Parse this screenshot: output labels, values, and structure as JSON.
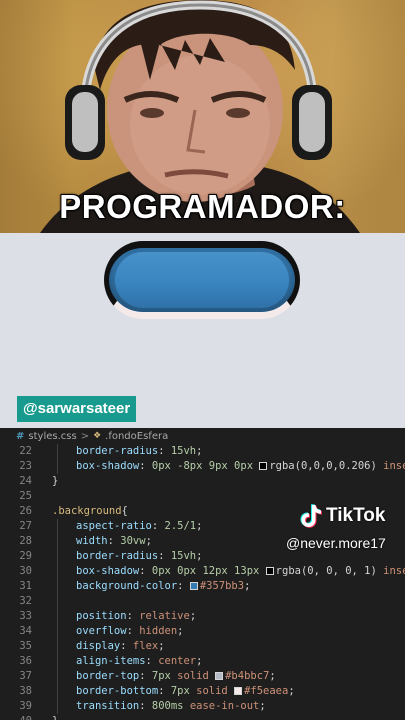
{
  "video": {
    "caption": "PROGRAMADOR:",
    "user_tag": "@sarwarsateer",
    "tiktok_brand": "TikTok",
    "tiktok_handle": "@never.more17"
  },
  "preview": {
    "pill_color": "#357bb3"
  },
  "editor": {
    "breadcrumb": {
      "file": "styles.css",
      "separator": ">",
      "selector": ".fondoEsfera"
    },
    "lines": [
      {
        "n": "22",
        "indent": true,
        "parts": [
          {
            "t": "border-radius",
            "c": "prop"
          },
          {
            "t": ": ",
            "c": "punc"
          },
          {
            "t": "15vh",
            "c": "num"
          },
          {
            "t": ";",
            "c": "punc"
          }
        ]
      },
      {
        "n": "23",
        "indent": true,
        "parts": [
          {
            "t": "box-shadow",
            "c": "prop"
          },
          {
            "t": ": ",
            "c": "punc"
          },
          {
            "t": "0px -8px 9px 0px ",
            "c": "num"
          },
          {
            "sw": "#000000"
          },
          {
            "t": "rgba(0,0,0,0.206) ",
            "c": "punc"
          },
          {
            "t": "inset",
            "c": "val"
          },
          {
            "t": ";",
            "c": "punc"
          }
        ]
      },
      {
        "n": "24",
        "indent": false,
        "parts": [
          {
            "t": "}",
            "c": "punc"
          }
        ]
      },
      {
        "n": "25",
        "indent": false,
        "parts": []
      },
      {
        "n": "26",
        "indent": false,
        "parts": [
          {
            "t": ".background",
            "c": "sel"
          },
          {
            "t": "{",
            "c": "punc"
          }
        ]
      },
      {
        "n": "27",
        "indent": true,
        "parts": [
          {
            "t": "aspect-ratio",
            "c": "prop"
          },
          {
            "t": ": ",
            "c": "punc"
          },
          {
            "t": "2.5/1",
            "c": "num"
          },
          {
            "t": ";",
            "c": "punc"
          }
        ]
      },
      {
        "n": "28",
        "indent": true,
        "parts": [
          {
            "t": "width",
            "c": "prop"
          },
          {
            "t": ": ",
            "c": "punc"
          },
          {
            "t": "30vw",
            "c": "num"
          },
          {
            "t": ";",
            "c": "punc"
          }
        ]
      },
      {
        "n": "29",
        "indent": true,
        "parts": [
          {
            "t": "border-radius",
            "c": "prop"
          },
          {
            "t": ": ",
            "c": "punc"
          },
          {
            "t": "15vh",
            "c": "num"
          },
          {
            "t": ";",
            "c": "punc"
          }
        ]
      },
      {
        "n": "30",
        "indent": true,
        "parts": [
          {
            "t": "box-shadow",
            "c": "prop"
          },
          {
            "t": ": ",
            "c": "punc"
          },
          {
            "t": "0px 0px 12px 13px ",
            "c": "num"
          },
          {
            "sw": "#000000"
          },
          {
            "t": "rgba(0, 0, 0, 1) ",
            "c": "punc"
          },
          {
            "t": "inset",
            "c": "val"
          },
          {
            "t": ";",
            "c": "punc"
          }
        ]
      },
      {
        "n": "31",
        "indent": true,
        "parts": [
          {
            "t": "background-color",
            "c": "prop"
          },
          {
            "t": ": ",
            "c": "punc"
          },
          {
            "sw": "#357bb3"
          },
          {
            "t": "#357bb3",
            "c": "val"
          },
          {
            "t": ";",
            "c": "punc"
          }
        ]
      },
      {
        "n": "32",
        "indent": true,
        "parts": []
      },
      {
        "n": "33",
        "indent": true,
        "parts": [
          {
            "t": "position",
            "c": "prop"
          },
          {
            "t": ": ",
            "c": "punc"
          },
          {
            "t": "relative",
            "c": "val"
          },
          {
            "t": ";",
            "c": "punc"
          }
        ]
      },
      {
        "n": "34",
        "indent": true,
        "parts": [
          {
            "t": "overflow",
            "c": "prop"
          },
          {
            "t": ": ",
            "c": "punc"
          },
          {
            "t": "hidden",
            "c": "val"
          },
          {
            "t": ";",
            "c": "punc"
          }
        ]
      },
      {
        "n": "35",
        "indent": true,
        "parts": [
          {
            "t": "display",
            "c": "prop"
          },
          {
            "t": ": ",
            "c": "punc"
          },
          {
            "t": "flex",
            "c": "val"
          },
          {
            "t": ";",
            "c": "punc"
          }
        ]
      },
      {
        "n": "36",
        "indent": true,
        "parts": [
          {
            "t": "align-items",
            "c": "prop"
          },
          {
            "t": ": ",
            "c": "punc"
          },
          {
            "t": "center",
            "c": "val"
          },
          {
            "t": ";",
            "c": "punc"
          }
        ]
      },
      {
        "n": "37",
        "indent": true,
        "parts": [
          {
            "t": "border-top",
            "c": "prop"
          },
          {
            "t": ": ",
            "c": "punc"
          },
          {
            "t": "7px ",
            "c": "num"
          },
          {
            "t": "solid ",
            "c": "val"
          },
          {
            "sw": "#b4bbc7"
          },
          {
            "t": "#b4bbc7",
            "c": "val"
          },
          {
            "t": ";",
            "c": "punc"
          }
        ]
      },
      {
        "n": "38",
        "indent": true,
        "parts": [
          {
            "t": "border-bottom",
            "c": "prop"
          },
          {
            "t": ": ",
            "c": "punc"
          },
          {
            "t": "7px ",
            "c": "num"
          },
          {
            "t": "solid ",
            "c": "val"
          },
          {
            "sw": "#f5eaea"
          },
          {
            "t": "#f5eaea",
            "c": "val"
          },
          {
            "t": ";",
            "c": "punc"
          }
        ]
      },
      {
        "n": "39",
        "indent": true,
        "parts": [
          {
            "t": "transition",
            "c": "prop"
          },
          {
            "t": ": ",
            "c": "punc"
          },
          {
            "t": "800ms ",
            "c": "num"
          },
          {
            "t": "ease-in-out",
            "c": "val"
          },
          {
            "t": ";",
            "c": "punc"
          }
        ]
      },
      {
        "n": "40",
        "indent": false,
        "parts": [
          {
            "t": "}",
            "c": "punc"
          }
        ]
      }
    ]
  }
}
